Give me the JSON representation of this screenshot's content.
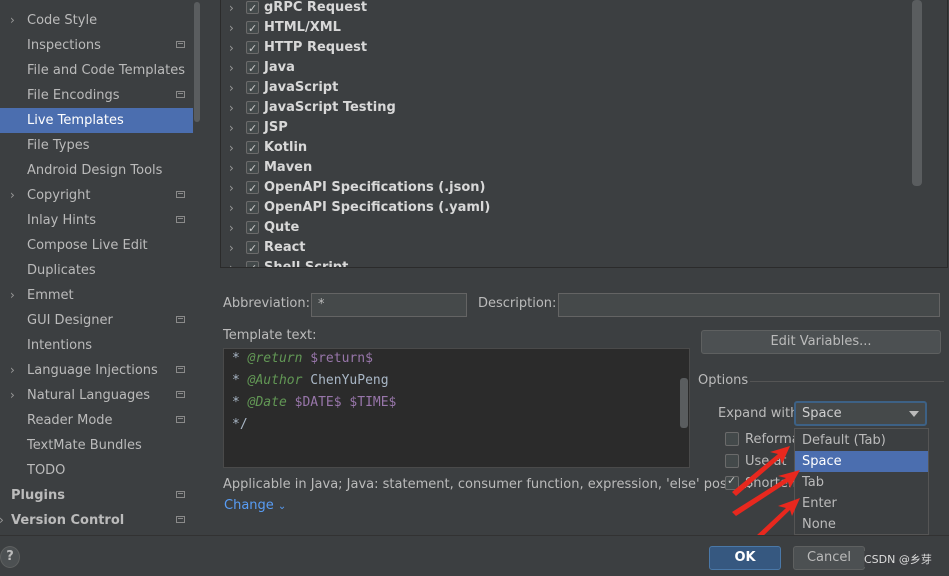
{
  "sidebar": {
    "items": [
      {
        "label": "Code Style",
        "chevron": true,
        "project": false
      },
      {
        "label": "Inspections",
        "chevron": false,
        "project": true
      },
      {
        "label": "File and Code Templates",
        "chevron": false,
        "project": false
      },
      {
        "label": "File Encodings",
        "chevron": false,
        "project": true
      },
      {
        "label": "Live Templates",
        "chevron": false,
        "project": false,
        "selected": true
      },
      {
        "label": "File Types",
        "chevron": false,
        "project": false
      },
      {
        "label": "Android Design Tools",
        "chevron": false,
        "project": false
      },
      {
        "label": "Copyright",
        "chevron": true,
        "project": true
      },
      {
        "label": "Inlay Hints",
        "chevron": false,
        "project": true
      },
      {
        "label": "Compose Live Edit",
        "chevron": false,
        "project": false
      },
      {
        "label": "Duplicates",
        "chevron": false,
        "project": false
      },
      {
        "label": "Emmet",
        "chevron": true,
        "project": false
      },
      {
        "label": "GUI Designer",
        "chevron": false,
        "project": true
      },
      {
        "label": "Intentions",
        "chevron": false,
        "project": false
      },
      {
        "label": "Language Injections",
        "chevron": true,
        "project": true
      },
      {
        "label": "Natural Languages",
        "chevron": true,
        "project": true
      },
      {
        "label": "Reader Mode",
        "chevron": false,
        "project": true
      },
      {
        "label": "TextMate Bundles",
        "chevron": false,
        "project": false
      },
      {
        "label": "TODO",
        "chevron": false,
        "project": false
      },
      {
        "label": "Plugins",
        "chevron": false,
        "project": true,
        "bold": true
      },
      {
        "label": "Version Control",
        "chevron": true,
        "project": true,
        "bold": true
      }
    ]
  },
  "tree": {
    "groups": [
      "gRPC Request",
      "HTML/XML",
      "HTTP Request",
      "Java",
      "JavaScript",
      "JavaScript Testing",
      "JSP",
      "Kotlin",
      "Maven",
      "OpenAPI Specifications (.json)",
      "OpenAPI Specifications (.yaml)",
      "Qute",
      "React",
      "Shell Script"
    ]
  },
  "form": {
    "abbreviation_label": "Abbreviation:",
    "abbreviation_value": "*",
    "description_label": "Description:",
    "description_value": "",
    "template_text_label": "Template text:",
    "edit_variables_label": "Edit Variables...",
    "template_lines": [
      {
        "prefix": "* ",
        "tag": "@return",
        "rest": " ",
        "var": "$return$"
      },
      {
        "prefix": "* ",
        "tag": "@Author",
        "rest": " ChenYuPeng",
        "var": ""
      },
      {
        "prefix": "* ",
        "tag": "@Date",
        "rest": " ",
        "var": "$DATE$ $TIME$"
      },
      {
        "prefix": "*/",
        "tag": "",
        "rest": "",
        "var": ""
      }
    ],
    "applicable_text": "Applicable in Java; Java: statement, consumer function, expression, 'else' positi...",
    "change_label": "Change"
  },
  "options": {
    "title": "Options",
    "expand_with_label": "Expand with",
    "expand_with_value": "Space",
    "reformat_label": "Reforma",
    "use_label": "Use",
    "use_suffix": "at",
    "shorten_label": "Shorten",
    "reformat_checked": false,
    "use_checked": false,
    "shorten_checked": true,
    "dropdown_options": [
      "Default (Tab)",
      "Space",
      "Tab",
      "Enter",
      "None"
    ],
    "selected_option": "Space"
  },
  "footer": {
    "help_label": "?",
    "ok_label": "OK",
    "cancel_label": "Cancel",
    "watermark": "CSDN @乡芽"
  },
  "colors": {
    "selection": "#4b6eaf",
    "arrow": "#e8281e",
    "ok_button": "#365880"
  }
}
